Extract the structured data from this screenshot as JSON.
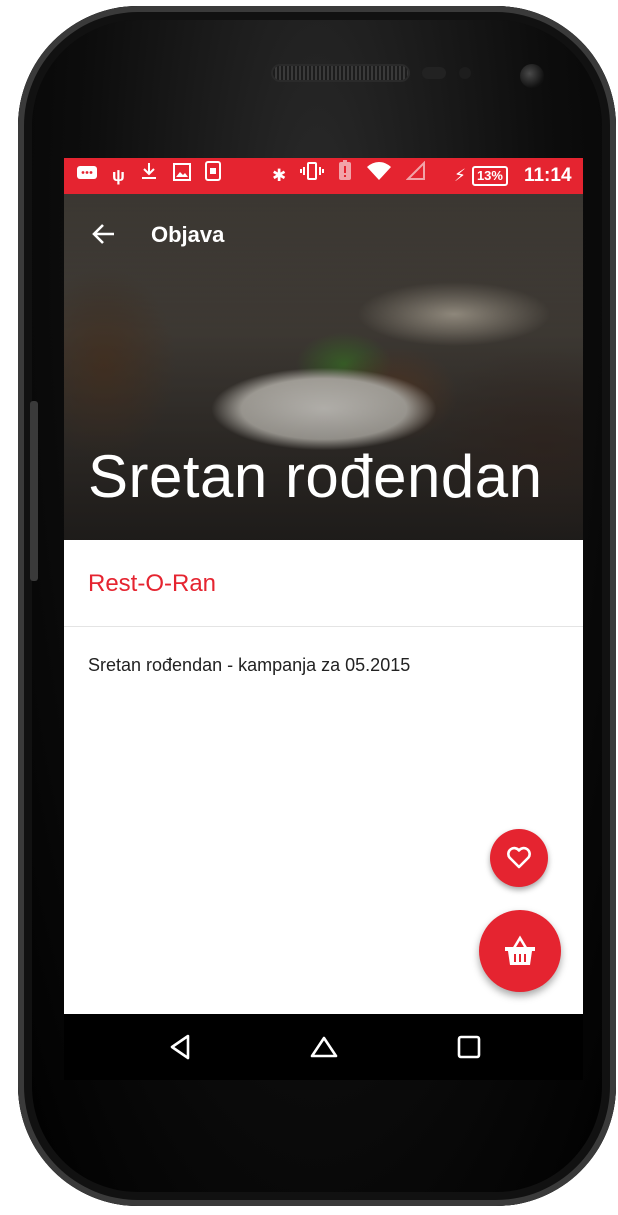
{
  "status_bar": {
    "battery_percent": "13%",
    "time": "11:14",
    "left_icons": [
      "message-icon",
      "usb-icon",
      "download-icon",
      "image-icon",
      "phone-card-icon"
    ],
    "right_icons": [
      "bluetooth-icon",
      "vibrate-icon",
      "battery-alert-icon",
      "wifi-icon",
      "signal-icon",
      "charging-icon"
    ]
  },
  "app_bar": {
    "title": "Objava"
  },
  "hero": {
    "title": "Sretan rođendan"
  },
  "restaurant": {
    "name": "Rest-O-Ran"
  },
  "post": {
    "text": "Sretan rođendan - kampanja za 05.2015"
  },
  "fabs": {
    "favorite_icon": "heart-icon",
    "basket_icon": "basket-icon"
  },
  "nav": {
    "icons": [
      "back-triangle-icon",
      "home-icon",
      "recents-icon"
    ]
  },
  "colors": {
    "accent": "#e52430",
    "text_primary": "#222222",
    "nav_background": "#000000"
  }
}
